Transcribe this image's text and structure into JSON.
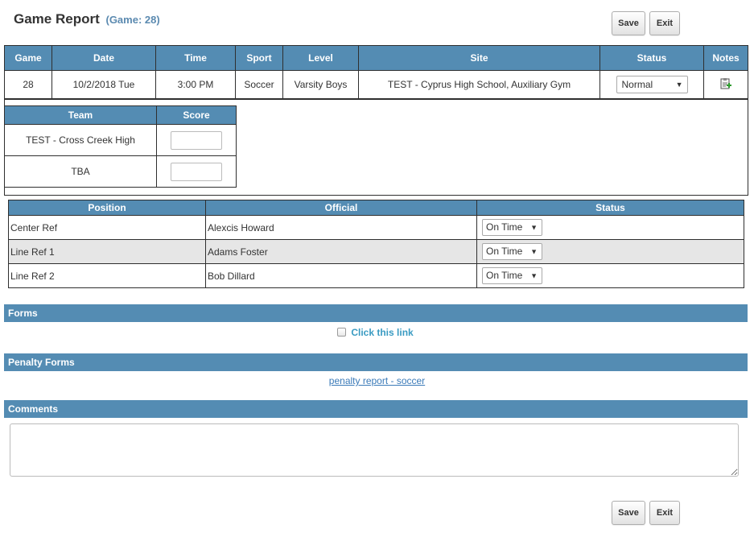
{
  "header": {
    "title": "Game Report",
    "game_label": "(Game: 28)",
    "save_label": "Save",
    "exit_label": "Exit"
  },
  "game_table": {
    "headers": [
      "Game",
      "Date",
      "Time",
      "Sport",
      "Level",
      "Site",
      "Status",
      "Notes"
    ],
    "row": {
      "game": "28",
      "date": "10/2/2018 Tue",
      "time": "3:00 PM",
      "sport": "Soccer",
      "level": "Varsity Boys",
      "site": "TEST - Cyprus High School, Auxiliary Gym",
      "status": "Normal",
      "notes_icon": "notes-add-icon"
    }
  },
  "team_table": {
    "headers": [
      "Team",
      "Score"
    ],
    "rows": [
      {
        "team": "TEST - Cross Creek High",
        "score": ""
      },
      {
        "team": "TBA",
        "score": ""
      }
    ]
  },
  "officials_table": {
    "headers": [
      "Position",
      "Official",
      "Status"
    ],
    "rows": [
      {
        "position": "Center Ref",
        "official": "Alexcis Howard",
        "status": "On Time"
      },
      {
        "position": "Line Ref 1",
        "official": "Adams Foster",
        "status": "On Time"
      },
      {
        "position": "Line Ref 2",
        "official": "Bob Dillard",
        "status": "On Time"
      }
    ]
  },
  "forms": {
    "title": "Forms",
    "link_text": "Click this link"
  },
  "penalty_forms": {
    "title": "Penalty Forms",
    "link_text": "penalty report - soccer"
  },
  "comments": {
    "title": "Comments",
    "value": ""
  },
  "footer": {
    "save_label": "Save",
    "exit_label": "Exit"
  },
  "colors": {
    "header_bg": "#548cb3",
    "title_accent": "#5b8ab0",
    "link": "#3a7ab8"
  }
}
